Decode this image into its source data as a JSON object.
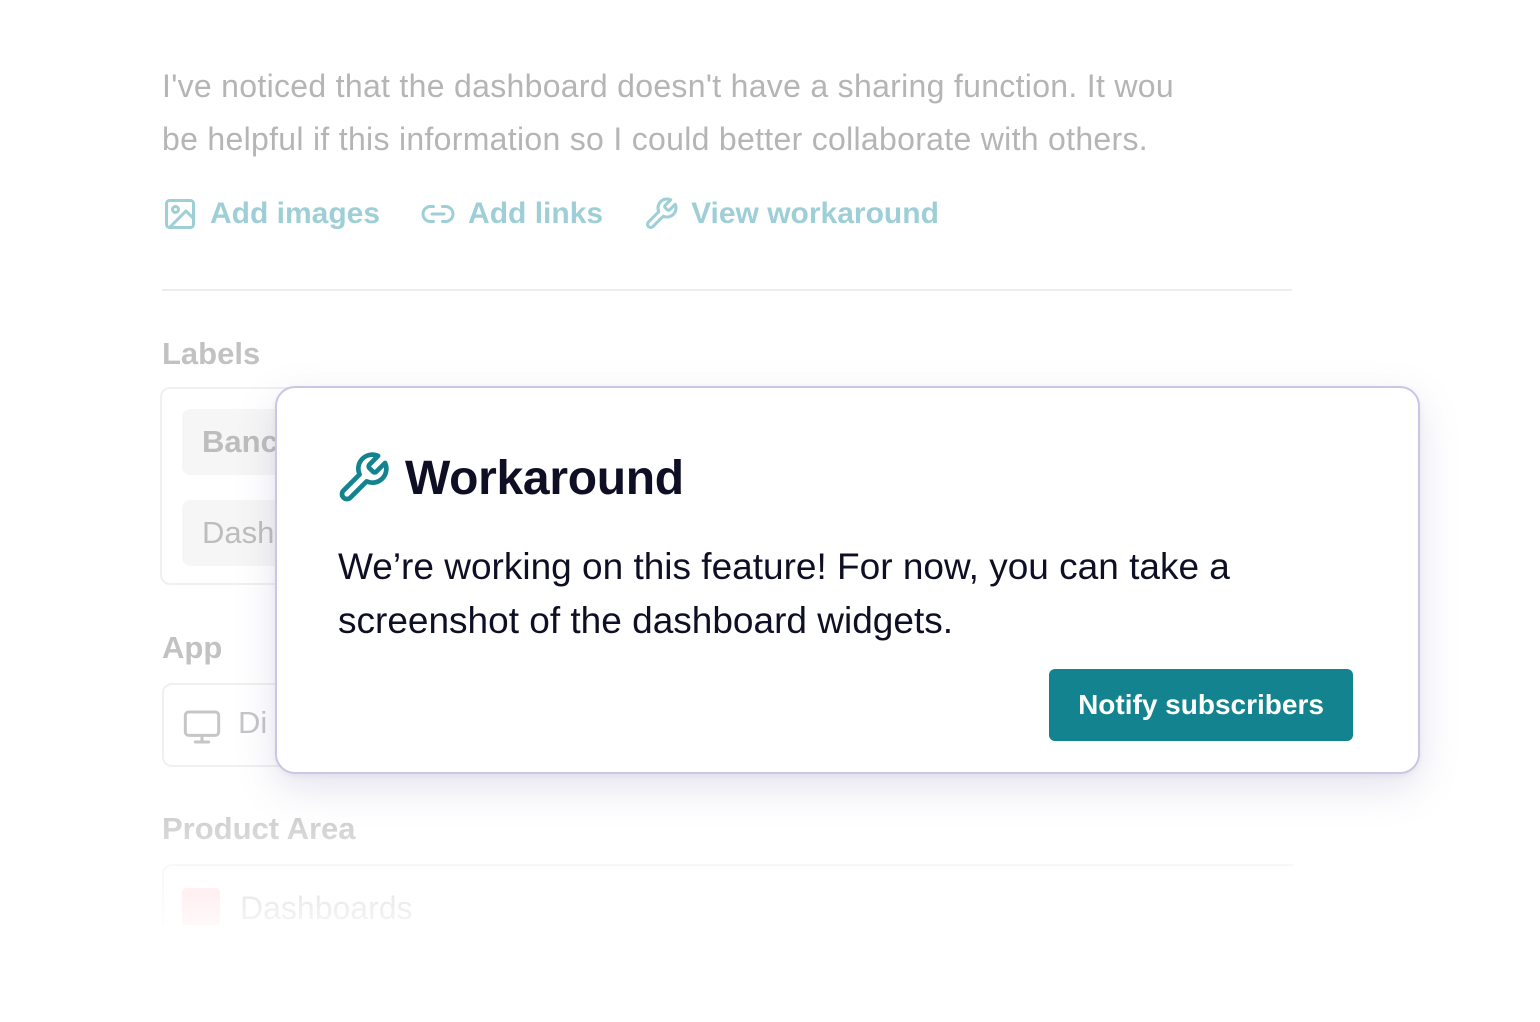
{
  "description": {
    "line1": "I've noticed that the dashboard doesn't have a sharing function. It wou",
    "line2": "be helpful if this information so I could better collaborate with others."
  },
  "actions": {
    "add_images": "Add images",
    "add_links": "Add links",
    "view_workaround": "View workaround"
  },
  "labels": {
    "title": "Labels",
    "chip1": "Banc",
    "chip2": "Dash"
  },
  "app": {
    "title": "App",
    "value": "Di"
  },
  "product_area": {
    "title": "Product Area",
    "value": "Dashboards",
    "swatch_color": "#ffd3d9"
  },
  "workaround": {
    "title": "Workaround",
    "body_line1": "We’re working on this feature! For now, you can take a",
    "body_line2": "screenshot of the dashboard widgets.",
    "button": "Notify subscribers",
    "accent_color": "#13838f"
  }
}
